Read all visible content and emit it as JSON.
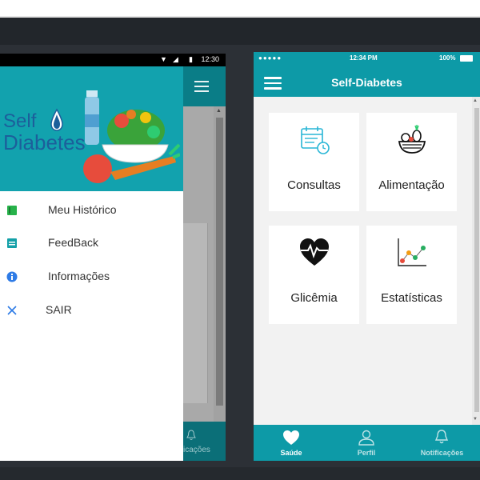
{
  "android": {
    "status_time": "12:30",
    "logo": {
      "line1": "Self",
      "line2": "Diabetes"
    },
    "menu": [
      {
        "label": "Meu Histórico",
        "icon": "green-book-icon"
      },
      {
        "label": "FeedBack",
        "icon": "teal-book-icon"
      },
      {
        "label": "Informações",
        "icon": "info-icon"
      },
      {
        "label": "SAIR",
        "icon": "close-icon"
      }
    ],
    "nav_partial_label": "icações"
  },
  "iphone": {
    "status_dots": "●●●●●",
    "status_time": "12:34 PM",
    "status_battery": "100%",
    "title": "Self-Diabetes",
    "tiles": [
      {
        "label": "Consultas",
        "icon": "calendar-clock-icon"
      },
      {
        "label": "Alimentação",
        "icon": "fruit-basket-icon"
      },
      {
        "label": "Glicêmia",
        "icon": "heart-pulse-icon"
      },
      {
        "label": "Estatísticas",
        "icon": "line-chart-icon"
      }
    ],
    "tabs": [
      {
        "label": "Saúde",
        "icon": "heart-icon"
      },
      {
        "label": "Perfil",
        "icon": "person-icon"
      },
      {
        "label": "Notificações",
        "icon": "bell-icon"
      }
    ]
  },
  "colors": {
    "teal": "#0d9aa7",
    "dark_teal": "#0a7d87",
    "logo_blue": "#1c5f9b",
    "background": "#2c3036"
  }
}
